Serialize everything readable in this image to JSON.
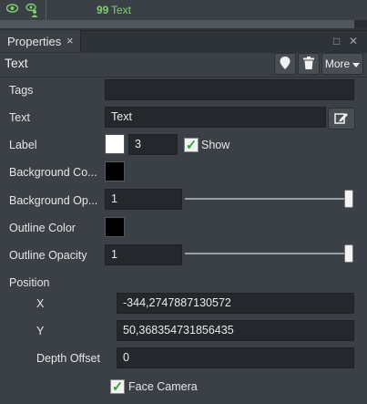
{
  "colors": {
    "accent_green": "#7ed06a",
    "panel_bg": "#3a4045",
    "field_bg": "#24282c"
  },
  "top_row": {
    "text": "Text",
    "quote_glyph": "99"
  },
  "tab": {
    "label": "Properties",
    "close": "×"
  },
  "window_controls": {
    "restore": "□",
    "close": "✕"
  },
  "header": {
    "title": "Text",
    "more_label": "More"
  },
  "props": {
    "tags": {
      "label": "Tags",
      "value": ""
    },
    "text": {
      "label": "Text",
      "value": "Text"
    },
    "label": {
      "label": "Label",
      "size": "3",
      "show_label": "Show",
      "show_checked": true,
      "color": "#ffffff"
    },
    "bg_color": {
      "label": "Background Co...",
      "color": "#000000"
    },
    "bg_opacity": {
      "label": "Background Op...",
      "value": "1",
      "slider_fraction": 1.0
    },
    "outline_color": {
      "label": "Outline Color",
      "color": "#000000"
    },
    "outline_opacity": {
      "label": "Outline Opacity",
      "value": "1",
      "slider_fraction": 1.0
    },
    "position": {
      "label": "Position",
      "x_label": "X",
      "x_value": "-344,2747887130572",
      "y_label": "Y",
      "y_value": "50,368354731856435",
      "depth_label": "Depth Offset",
      "depth_value": "0"
    },
    "face_camera": {
      "label": "Face Camera",
      "checked": true
    }
  }
}
